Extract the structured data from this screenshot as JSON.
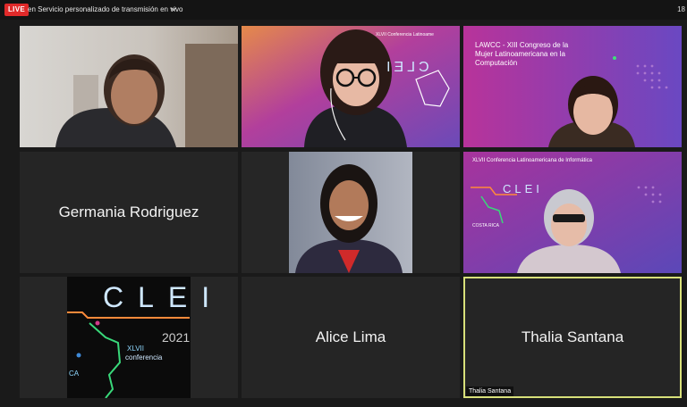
{
  "topbar": {
    "live_label": "LIVE",
    "stream_text": "en Servicio personalizado de transmisión en vivo",
    "clock": "18"
  },
  "tiles": {
    "germania": {
      "name": "Germania Rodriguez"
    },
    "alice": {
      "name": "Alice Lima"
    },
    "thalia": {
      "name": "Thalia Santana",
      "label": "Thalia Santana"
    }
  },
  "slides": {
    "lawcc": "LAWCC - XIII Congreso de la Mujer Latinoamericana en la Computación",
    "xlvii": "XLVII Conferencia Latinoamericana de Informática",
    "clei_word": "CLEI",
    "year": "2021",
    "xlvii_short": "XLVII",
    "conferencia": "conferencia",
    "ca": "CA",
    "costa_rica": "COSTA RICA",
    "xlvii_mirror": "XLVII Conferencia Latinoame"
  },
  "colors": {
    "accent_live": "#e02a2a",
    "active_border": "#d8e07a"
  }
}
